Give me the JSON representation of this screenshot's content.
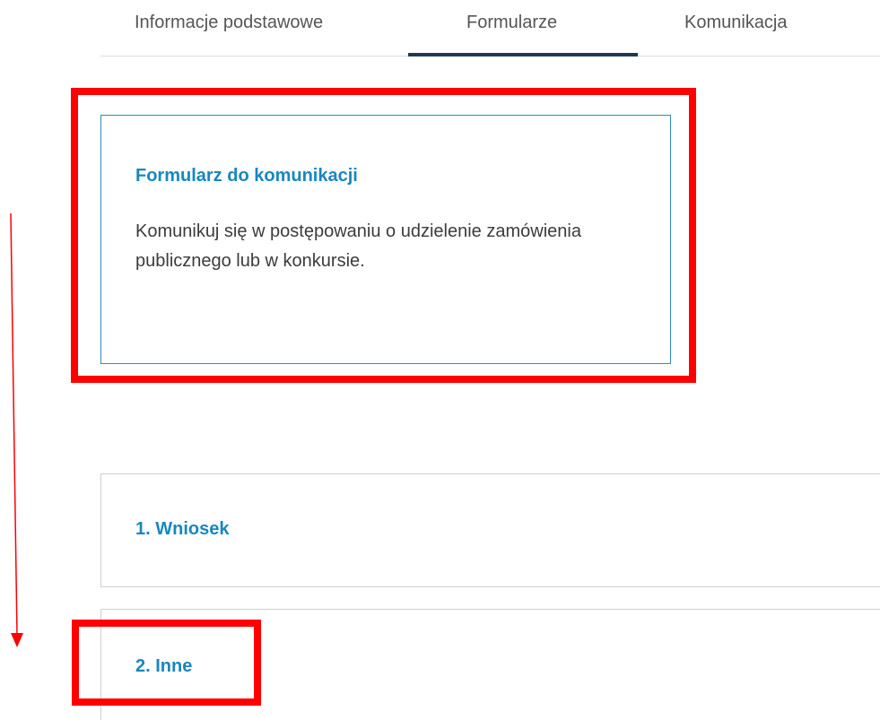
{
  "tabs": [
    {
      "label": "Informacje podstawowe"
    },
    {
      "label": "Formularze"
    },
    {
      "label": "Komunikacja"
    }
  ],
  "active_tab": "Formularze",
  "form_card": {
    "title": "Formularz do komunikacji",
    "description": "Komunikuj się w postępowaniu o udzielenie zamówienia publicznego lub w konkursie."
  },
  "sections": [
    {
      "title": "1. Wniosek"
    },
    {
      "title": "2. Inne"
    }
  ],
  "colors": {
    "accent": "#1a86c0",
    "highlight": "#ff0000",
    "tab_underline": "#1f3a4f"
  }
}
